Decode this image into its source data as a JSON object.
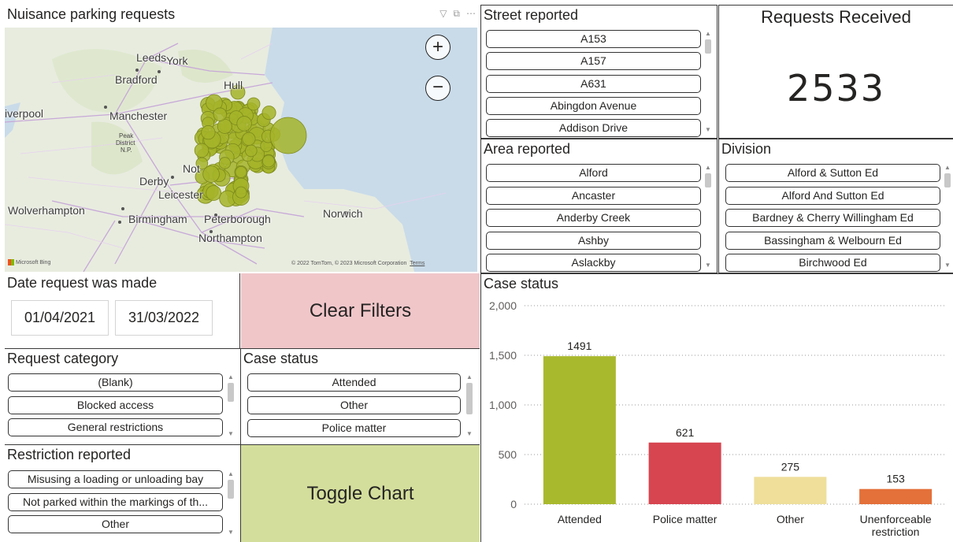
{
  "map": {
    "title": "Nuisance parking requests",
    "header_icons": [
      "filter-icon",
      "focus-mode-icon",
      "more-options-icon"
    ],
    "zoom_in": "+",
    "zoom_out": "−",
    "attribution": "© 2022 TomTom, © 2023 Microsoft Corporation",
    "terms": "Terms",
    "bing": "Microsoft Bing",
    "bubble_color": "#a5b429",
    "places": [
      "Leeds",
      "York",
      "Bradford",
      "Hull",
      "iverpool",
      "Manchester",
      "Peak",
      "District",
      "N.P.",
      "Not",
      "Derby",
      "Leicester",
      "Wolverhampton",
      "Birmingham",
      "Peterborough",
      "Norwich",
      "Northampton"
    ]
  },
  "street": {
    "title": "Street reported",
    "items": [
      "A153",
      "A157",
      "A631",
      "Abingdon Avenue",
      "Addison Drive"
    ]
  },
  "kpi": {
    "title": "Requests Received",
    "value": "2533"
  },
  "area": {
    "title": "Area reported",
    "items": [
      "Alford",
      "Ancaster",
      "Anderby Creek",
      "Ashby",
      "Aslackby"
    ]
  },
  "division": {
    "title": "Division",
    "items": [
      "Alford & Sutton Ed",
      "Alford And Sutton Ed",
      "Bardney & Cherry Willingham Ed",
      "Bassingham & Welbourn Ed",
      "Birchwood Ed"
    ]
  },
  "date": {
    "title": "Date request was made",
    "start": "01/04/2021",
    "end": "31/03/2022"
  },
  "clear_filters": {
    "label": "Clear Filters",
    "color": "#f0c6c9"
  },
  "request_category": {
    "title": "Request category",
    "items": [
      "(Blank)",
      "Blocked access",
      "General restrictions"
    ]
  },
  "case_status_slicer": {
    "title": "Case status",
    "items": [
      "Attended",
      "Other",
      "Police matter"
    ]
  },
  "restriction": {
    "title": "Restriction reported",
    "items": [
      "Misusing a loading or unloading bay",
      "Not parked within the markings of th...",
      "Other"
    ]
  },
  "toggle_chart": {
    "label": "Toggle Chart",
    "color": "#d4de9c"
  },
  "chart_panel": {
    "title": "Case status"
  },
  "chart_data": {
    "type": "bar",
    "title": "Case status",
    "categories": [
      "Attended",
      "Police matter",
      "Other",
      "Unenforceable restriction"
    ],
    "category_lines": [
      [
        "Attended"
      ],
      [
        "Police matter"
      ],
      [
        "Other"
      ],
      [
        "Unenforceable",
        "restriction"
      ]
    ],
    "values": [
      1491,
      621,
      275,
      153
    ],
    "colors": [
      "#a9b92e",
      "#d64550",
      "#efdf9b",
      "#e4703a"
    ],
    "yticks": [
      "0",
      "500",
      "1,000",
      "1,500",
      "2,000"
    ],
    "ytick_values": [
      0,
      500,
      1000,
      1500,
      2000
    ],
    "ylim": [
      0,
      2000
    ],
    "grid": true,
    "xlabel": "",
    "ylabel": ""
  }
}
